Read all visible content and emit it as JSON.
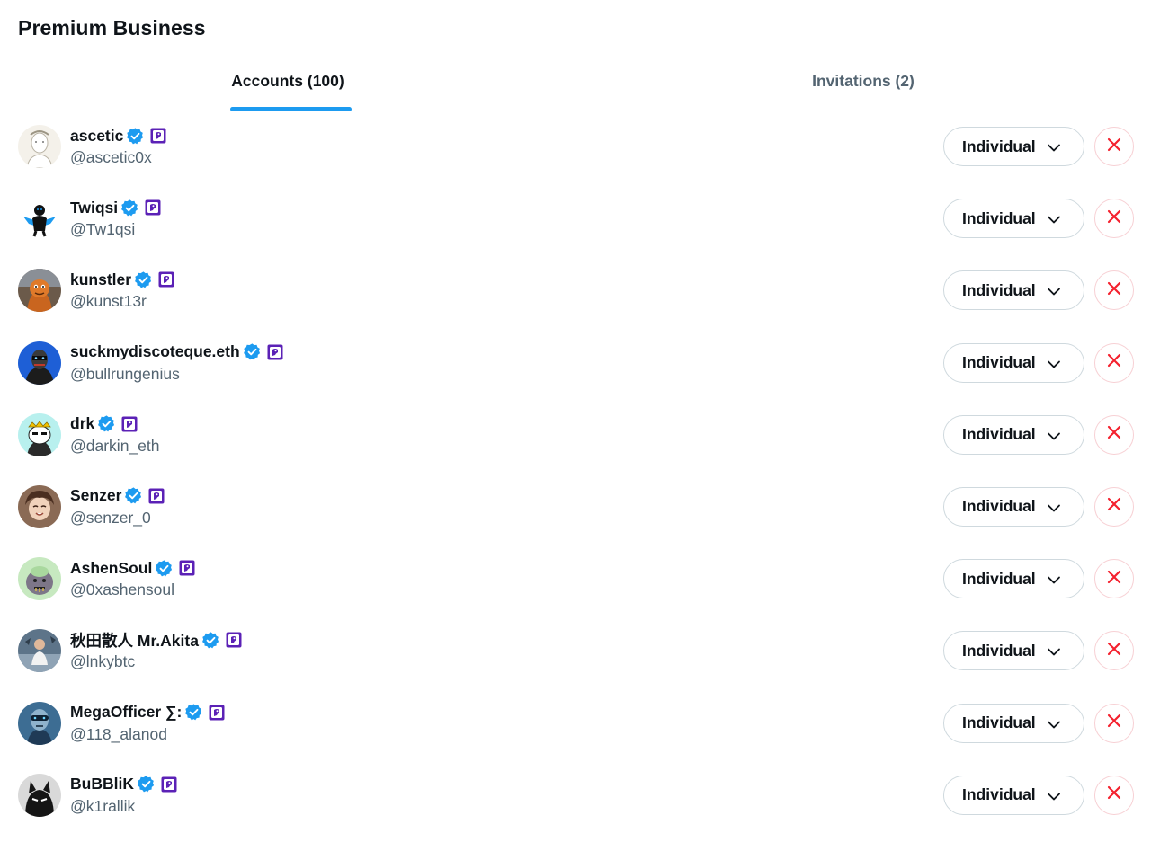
{
  "header": {
    "title": "Premium Business"
  },
  "tabs": [
    {
      "label": "Accounts (100)",
      "active": true
    },
    {
      "label": "Invitations (2)",
      "active": false
    }
  ],
  "colors": {
    "accent": "#1d9bf0",
    "remove": "#f4212e",
    "affiliate": "#5b21b6",
    "muted": "#536471"
  },
  "icons": {
    "verified": "verified-badge-icon",
    "affiliate": "affiliate-badge-icon",
    "dropdown": "chevron-down-icon",
    "remove": "close-x-icon"
  },
  "accounts": [
    {
      "name": "ascetic",
      "handle": "@ascetic0x",
      "role": "Individual"
    },
    {
      "name": "Twiqsi",
      "handle": "@Tw1qsi",
      "role": "Individual"
    },
    {
      "name": "kunstler",
      "handle": "@kunst13r",
      "role": "Individual"
    },
    {
      "name": "suckmydiscoteque.eth",
      "handle": "@bullrungenius",
      "role": "Individual"
    },
    {
      "name": "drk",
      "handle": "@darkin_eth",
      "role": "Individual"
    },
    {
      "name": "Senzer",
      "handle": "@senzer_0",
      "role": "Individual"
    },
    {
      "name": "AshenSoul",
      "handle": "@0xashensoul",
      "role": "Individual"
    },
    {
      "name": "秋田散人 Mr.Akita",
      "handle": "@lnkybtc",
      "role": "Individual"
    },
    {
      "name": "MegaOfficer ∑:",
      "handle": "@118_alanod",
      "role": "Individual"
    },
    {
      "name": "BuBBliK",
      "handle": "@k1rallik",
      "role": "Individual"
    }
  ]
}
